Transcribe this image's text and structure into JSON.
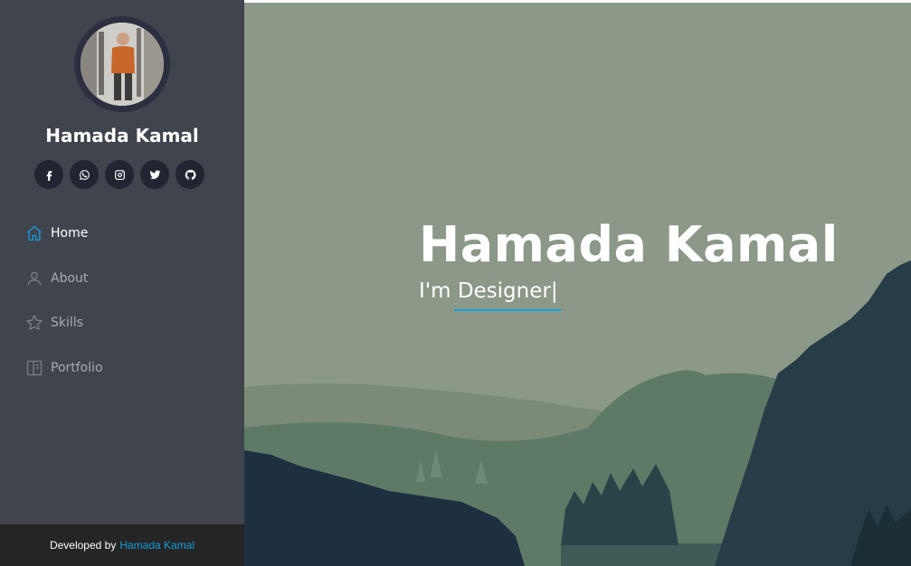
{
  "profile": {
    "name": "Hamada Kamal"
  },
  "social": [
    {
      "icon": "facebook-icon"
    },
    {
      "icon": "whatsapp-icon"
    },
    {
      "icon": "instagram-icon"
    },
    {
      "icon": "twitter-icon"
    },
    {
      "icon": "github-icon"
    }
  ],
  "nav": {
    "items": [
      {
        "label": "Home",
        "icon": "home-icon",
        "active": true
      },
      {
        "label": "About",
        "icon": "person-icon",
        "active": false
      },
      {
        "label": "Skills",
        "icon": "star-icon",
        "active": false
      },
      {
        "label": "Portfolio",
        "icon": "portfolio-icon",
        "active": false
      }
    ]
  },
  "footer": {
    "prefix": "Developed by",
    "link": "Hamada Kamal"
  },
  "hero": {
    "title": "Hamada Kamal",
    "subtitle": "I'm Designer|"
  },
  "colors": {
    "accent": "#149ddd",
    "sidebar": "#40444c",
    "footer": "#252525"
  }
}
